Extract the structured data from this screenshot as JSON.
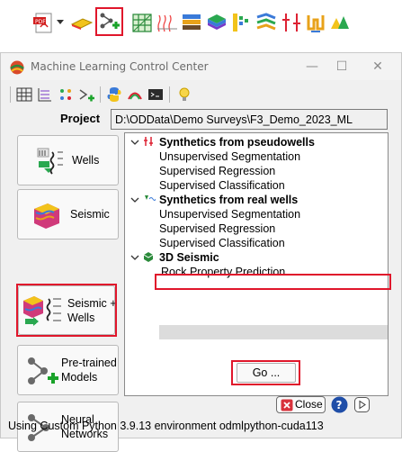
{
  "window": {
    "title": "Machine Learning Control Center",
    "minimize": "—",
    "maximize": "☐",
    "close": "✕"
  },
  "project": {
    "label": "Project",
    "path": "D:\\ODData\\Demo Surveys\\F3_Demo_2023_ML"
  },
  "sidebar": {
    "items": [
      {
        "label": "Wells"
      },
      {
        "label": "Seismic"
      },
      {
        "label": "Seismic +\nWells"
      },
      {
        "label": "Pre-trained\nModels"
      },
      {
        "label": "Neural\nNetworks"
      }
    ]
  },
  "tree": {
    "groups": [
      {
        "label": "Synthetics from pseudowells",
        "children": [
          "Unsupervised Segmentation",
          "Supervised Regression",
          "Supervised Classification"
        ]
      },
      {
        "label": "Synthetics from real wells",
        "children": [
          "Unsupervised Segmentation",
          "Supervised Regression",
          "Supervised Classification"
        ]
      },
      {
        "label": "3D Seismic",
        "children": [
          "Rock Property Prediction"
        ]
      }
    ],
    "selected": "Rock Property Prediction"
  },
  "buttons": {
    "go": "Go ...",
    "close": "Close",
    "help": "?"
  },
  "status": "Using Custom Python 3.9.13 environment odmlpython-cuda113",
  "colors": {
    "highlight": "#e0162b",
    "selection": "#dcdcdc"
  }
}
